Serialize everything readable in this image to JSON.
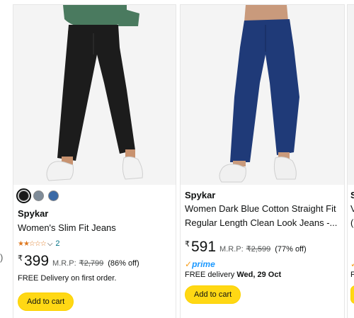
{
  "edge_left": ")",
  "products": [
    {
      "brand": "Spykar",
      "title": "Women's Slim Fit Jeans",
      "swatches": [
        "#1a1a1a",
        "#7f8c99",
        "#3b6aa6"
      ],
      "rating_stars": 2.5,
      "rating_count": "2",
      "currency": "₹",
      "price": "399",
      "mrp_label": "M.R.P:",
      "mrp": "₹2,799",
      "discount": "(86% off)",
      "delivery_text": "FREE Delivery on first order.",
      "cart_label": "Add to cart"
    },
    {
      "brand": "Spykar",
      "title_line1": "Women Dark Blue Cotton Straight Fit",
      "title_line2": "Regular Length Clean Look Jeans -...",
      "currency": "₹",
      "price": "591",
      "mrp_label": "M.R.P:",
      "mrp": "₹2,599",
      "discount": "(77% off)",
      "prime_label": "prime",
      "delivery_prefix": "FREE delivery",
      "delivery_date": "Wed, 29 Oct",
      "cart_label": "Add to cart"
    },
    {
      "brand": "S",
      "title_line1": "V",
      "title_line2": "(",
      "delivery_text": "F"
    }
  ],
  "icons": [
    "star-icon",
    "chevron-down-icon",
    "prime-check-icon"
  ]
}
